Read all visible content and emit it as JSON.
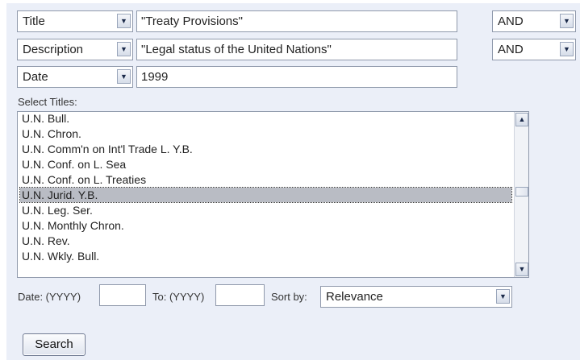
{
  "rows": [
    {
      "field": "Title",
      "value": "\"Treaty Provisions\"",
      "operator": "AND"
    },
    {
      "field": "Description",
      "value": "\"Legal status of the United Nations\"",
      "operator": "AND"
    },
    {
      "field": "Date",
      "value": "1999"
    }
  ],
  "titles_label": "Select Titles:",
  "titles": [
    "U.N. Bull.",
    "U.N. Chron.",
    "U.N. Comm'n on Int'l Trade L. Y.B.",
    "U.N. Conf. on L. Sea",
    "U.N. Conf. on L. Treaties",
    "U.N. Jurid. Y.B.",
    "U.N. Leg. Ser.",
    "U.N. Monthly Chron.",
    "U.N. Rev.",
    "U.N. Wkly. Bull."
  ],
  "selected_title": "U.N. Jurid. Y.B.",
  "date_from_label": "Date: (YYYY)",
  "date_from_value": "",
  "date_to_label": "To: (YYYY)",
  "date_to_value": "",
  "sort_label": "Sort by:",
  "sort_value": "Relevance",
  "search_button": "Search"
}
